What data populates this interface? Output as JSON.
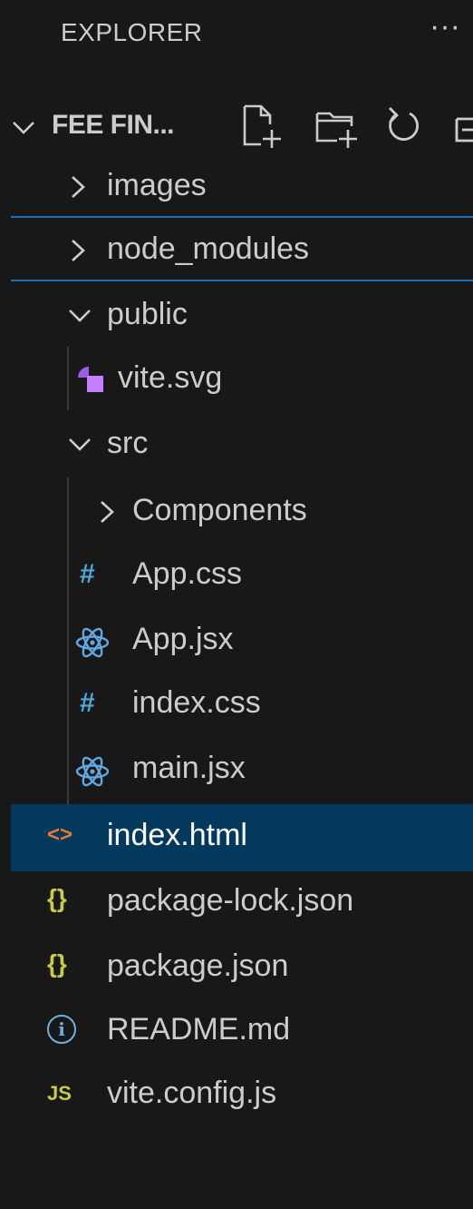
{
  "header": {
    "title": "EXPLORER",
    "more": "···"
  },
  "workspace": {
    "name": "FEE FIN..."
  },
  "tree": {
    "images": "images",
    "node_modules": "node_modules",
    "public": "public",
    "vite_svg": "vite.svg",
    "src": "src",
    "components": "Components",
    "app_css": "App.css",
    "app_jsx": "App.jsx",
    "index_css": "index.css",
    "main_jsx": "main.jsx",
    "index_html": "index.html",
    "package_lock": "package-lock.json",
    "package_json": "package.json",
    "readme": "README.md",
    "vite_config": "vite.config.js"
  },
  "icons": {
    "css_glyph": "#",
    "html_glyph": "<>",
    "json_glyph": "{}",
    "js_glyph": "JS",
    "info_glyph": "i"
  },
  "colors": {
    "background": "#181818",
    "selected_row": "#04395e",
    "focus_line": "#1f6fb5",
    "css_icon": "#4fa8de",
    "react_icon": "#5fa8e0",
    "html_icon": "#e37933",
    "json_icon": "#cbcb41",
    "js_icon": "#cbcb41",
    "info_icon": "#6fb0e0",
    "vite_icon_a": "#9b5de5",
    "vite_icon_b": "#c77dff"
  }
}
